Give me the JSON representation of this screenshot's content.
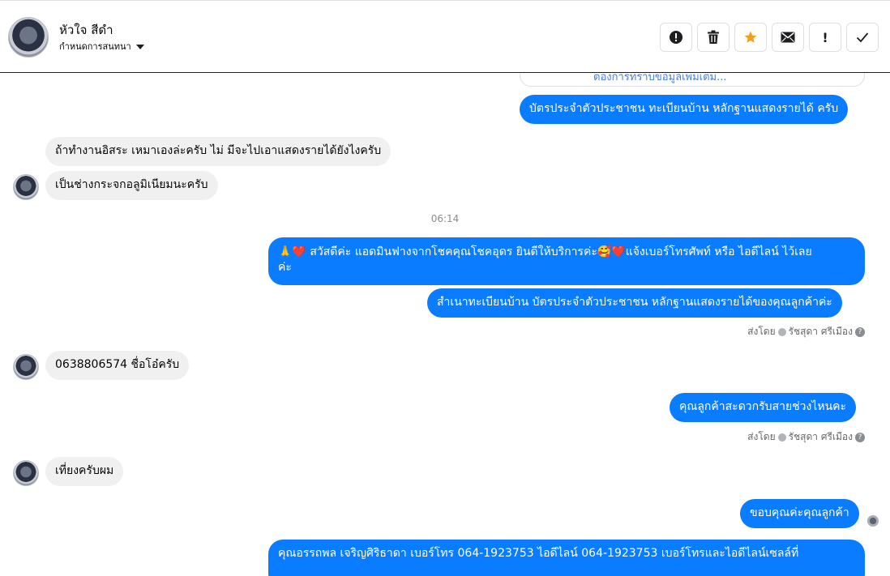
{
  "header": {
    "contact_name": "หัวใจ สีดำ",
    "assign_label": "กำหนดการสนทนา",
    "actions": {
      "alert": "alert-icon",
      "delete": "trash-icon",
      "star": "star-icon",
      "mail": "mail-icon",
      "important": "!",
      "done": "check-icon"
    }
  },
  "colors": {
    "outgoing": "#0a7cff",
    "incoming": "#f0f0f0",
    "star": "#f59e1b"
  },
  "thread": {
    "ghost_text": "ต้องการทราบข้อมูลเพิ่มเติม...",
    "m1": "บัตรประจำตัวประชาชน ทะเบียนบ้าน หลักฐานแสดงรายได้ ครับ",
    "m2": "ถ้าทำงานอิสระ เหมาเองล่ะครับ ไม่ มีจะไปเอาแสดงรายได้ยังไงครับ",
    "m3": "เป็นช่างกระจกอลูมิเนียมนะครับ",
    "time": "06:14",
    "m4_line1": "🙏❤️ สวัสดีค่ะ แอดมินฟางจากโชคคุณโชคอุดร ยินดีให้บริการค่ะ🥰❤️แจ้งเบอร์โทรศัพท์ หรือ ไอดีไลน์  ไว้เลย",
    "m4_line2": "ค่ะ",
    "m5": "สำเนาทะเบียนบ้าน บัตรประจำตัวประชาชน หลักฐานแสดงรายได้ของคุณลูกค้าค่ะ",
    "sent_by_label": "ส่งโดย",
    "sent_by_name": "รัชสุดา ศรีเมือง",
    "help": "?",
    "m6": "0638806574 ชื่อโอ๋ครับ",
    "m7": "คุณลูกค้าสะดวกรับสายช่วงไหนคะ",
    "m8": "เที่ยงครับผม",
    "m9": "ขอบคุณค่ะคุณลูกค้า",
    "m10": "คุณอรรถพล เจริญศิริธาดา      เบอร์โทร 064-1923753 ไอดีไลน์ 064-1923753   เบอร์โทรและไอดีไลน์เซลล์ที่"
  }
}
